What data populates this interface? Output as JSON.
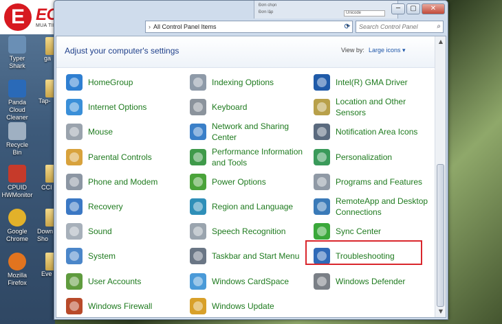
{
  "logo": {
    "letter": "E",
    "name": "ECO-MART",
    "reg": "®",
    "tagline": "MUA TIẾT KIỆM - SỐNG AN TÂM"
  },
  "desktop": {
    "icons": [
      {
        "label": "Typer Shark",
        "color": "#6a8fb5"
      },
      {
        "label": "Panda Cloud Cleaner",
        "color": "#2a6ab8"
      },
      {
        "label": "Recycle Bin",
        "color": "#9fb0c2"
      },
      {
        "label": "CPUID HWMonitor",
        "color": "#c63a2a"
      },
      {
        "label": "Google Chrome",
        "color": "#e2b12a"
      },
      {
        "label": "Mozilla Firefox",
        "color": "#e2741f"
      }
    ],
    "second_col": [
      "ga",
      "Tap-",
      "CCI",
      "Down Sho",
      "Eve"
    ]
  },
  "bg_window": {
    "line1": "Đơn chọn",
    "line2": "Đơn lập",
    "field": "Unicode"
  },
  "window": {
    "buttons": {
      "minimize": "─",
      "maximize": "▢",
      "close": "✕"
    },
    "address": {
      "sep": "›",
      "path": "All Control Panel Items",
      "drop": "▼",
      "refresh": "⟳"
    },
    "search": {
      "placeholder": "Search Control Panel",
      "icon": "⌕"
    },
    "title": "Adjust your computer's settings",
    "view_by_label": "View by:",
    "view_by_value": "Large icons ▾"
  },
  "items": [
    {
      "label": "HomeGroup",
      "icon": "homegroup-icon",
      "color": "#2f7fd1"
    },
    {
      "label": "Internet Options",
      "icon": "internet-options-icon",
      "color": "#3a8fd8"
    },
    {
      "label": "Mouse",
      "icon": "mouse-icon",
      "color": "#9aa3ad"
    },
    {
      "label": "Parental Controls",
      "icon": "parental-controls-icon",
      "color": "#d8a23c"
    },
    {
      "label": "Phone and Modem",
      "icon": "phone-modem-icon",
      "color": "#8c96a3"
    },
    {
      "label": "Recovery",
      "icon": "recovery-icon",
      "color": "#3b78c4"
    },
    {
      "label": "Sound",
      "icon": "sound-icon",
      "color": "#a7b0ba"
    },
    {
      "label": "System",
      "icon": "system-icon",
      "color": "#4b86c9"
    },
    {
      "label": "User Accounts",
      "icon": "user-accounts-icon",
      "color": "#5f9b3e"
    },
    {
      "label": "Windows Firewall",
      "icon": "windows-firewall-icon",
      "color": "#b84a2a"
    },
    {
      "label": "Indexing Options",
      "icon": "indexing-options-icon",
      "color": "#8e9aa8"
    },
    {
      "label": "Keyboard",
      "icon": "keyboard-icon",
      "color": "#8b939c"
    },
    {
      "label": "Network and Sharing Center",
      "icon": "network-sharing-icon",
      "color": "#3a7fc8"
    },
    {
      "label": "Performance Information and Tools",
      "icon": "performance-icon",
      "color": "#3f9a4a"
    },
    {
      "label": "Power Options",
      "icon": "power-options-icon",
      "color": "#4aa33a"
    },
    {
      "label": "Region and Language",
      "icon": "region-language-icon",
      "color": "#2f8fb8"
    },
    {
      "label": "Speech Recognition",
      "icon": "speech-recognition-icon",
      "color": "#9aa4ae"
    },
    {
      "label": "Taskbar and Start Menu",
      "icon": "taskbar-start-icon",
      "color": "#6a7685"
    },
    {
      "label": "Windows CardSpace",
      "icon": "cardspace-icon",
      "color": "#4a9ad8"
    },
    {
      "label": "Windows Update",
      "icon": "windows-update-icon",
      "color": "#d8a02a"
    },
    {
      "label": "Intel(R) GMA Driver",
      "icon": "intel-gma-icon",
      "color": "#1f5aa8"
    },
    {
      "label": "Location and Other Sensors",
      "icon": "location-sensors-icon",
      "color": "#b8a04a"
    },
    {
      "label": "Notification Area Icons",
      "icon": "notification-area-icon",
      "color": "#5a6a7e"
    },
    {
      "label": "Personalization",
      "icon": "personalization-icon",
      "color": "#3a9a5a"
    },
    {
      "label": "Programs and Features",
      "icon": "programs-features-icon",
      "color": "#8f99a5"
    },
    {
      "label": "RemoteApp and Desktop Connections",
      "icon": "remoteapp-icon",
      "color": "#3a7ab8"
    },
    {
      "label": "Sync Center",
      "icon": "sync-center-icon",
      "color": "#3aa83a"
    },
    {
      "label": "Troubleshooting",
      "icon": "troubleshooting-icon",
      "color": "#2f6ab8"
    },
    {
      "label": "Windows Defender",
      "icon": "windows-defender-icon",
      "color": "#7a7f86"
    }
  ],
  "highlight_color": "#d9262c"
}
